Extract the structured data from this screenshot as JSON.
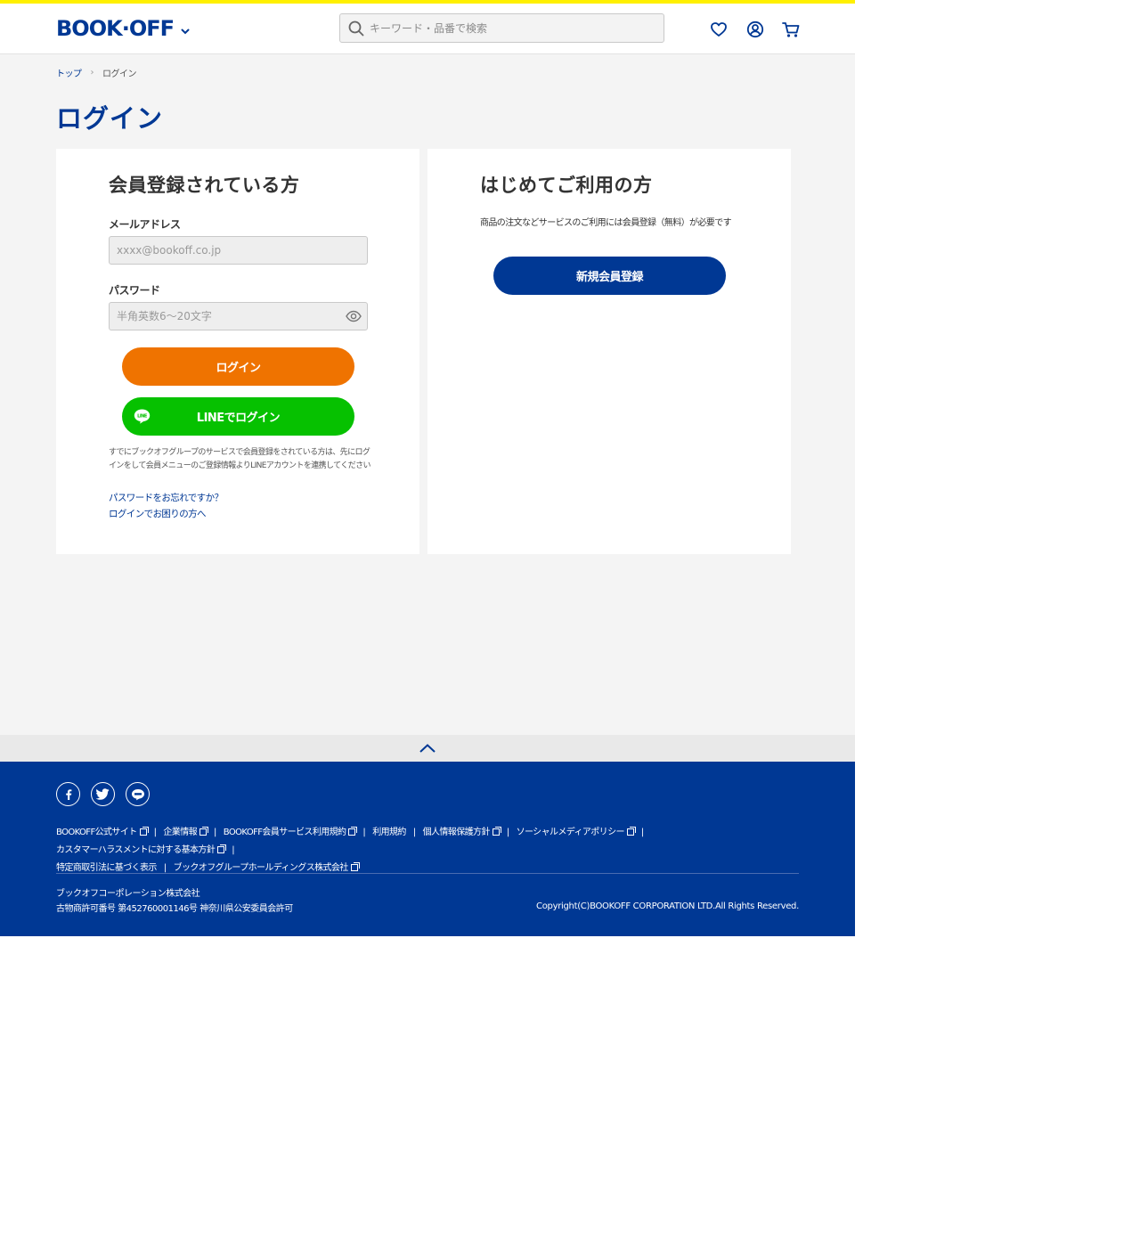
{
  "colors": {
    "brand_blue": "#003894",
    "accent_yellow": "#fff000",
    "login_orange": "#ef7300",
    "line_green": "#06c100"
  },
  "header": {
    "logo_text": "BOOK·OFF",
    "search_placeholder": "キーワード・品番で検索",
    "icons": [
      "heart-icon",
      "account-icon",
      "cart-icon"
    ]
  },
  "breadcrumb": {
    "top": "トップ",
    "current": "ログイン"
  },
  "page_title": "ログイン",
  "member_card": {
    "title": "会員登録されている方",
    "email_label": "メールアドレス",
    "email_placeholder": "xxxx@bookoff.co.jp",
    "password_label": "パスワード",
    "password_placeholder": "半角英数6～20文字",
    "login_button": "ログイン",
    "line_button": "LINEでログイン",
    "line_badge": "LINE",
    "note": "すでにブックオフグループのサービスで会員登録をされている方は、先にログインをして会員メニューのご登録情報よりLINEアカウントを連携してください",
    "forgot_link": "パスワードをお忘れですか？",
    "help_link": "ログインでお困りの方へ"
  },
  "new_card": {
    "title": "はじめてご利用の方",
    "description": "商品の注文などサービスのご利用には会員登録（無料）が必要です",
    "register_button": "新規会員登録"
  },
  "footer": {
    "social": [
      "facebook-icon",
      "twitter-icon",
      "line-icon"
    ],
    "links": [
      {
        "label": "BOOKOFF公式サイト",
        "external": true
      },
      {
        "label": "企業情報",
        "external": true
      },
      {
        "label": "BOOKOFF会員サービス利用規約",
        "external": true
      },
      {
        "label": "利用規約",
        "external": false
      },
      {
        "label": "個人情報保護方針",
        "external": true
      },
      {
        "label": "ソーシャルメディアポリシー",
        "external": true
      },
      {
        "label": "カスタマーハラスメントに対する基本方針",
        "external": true
      },
      {
        "label": "特定商取引法に基づく表示",
        "external": false
      },
      {
        "label": "ブックオフグループホールディングス株式会社",
        "external": true
      }
    ],
    "company_name": "ブックオフコーポレーション株式会社",
    "license": "古物商許可番号 第452760001146号 神奈川県公安委員会許可",
    "copyright": "Copyright(C)BOOKOFF CORPORATION LTD.All Rights Reserved."
  }
}
